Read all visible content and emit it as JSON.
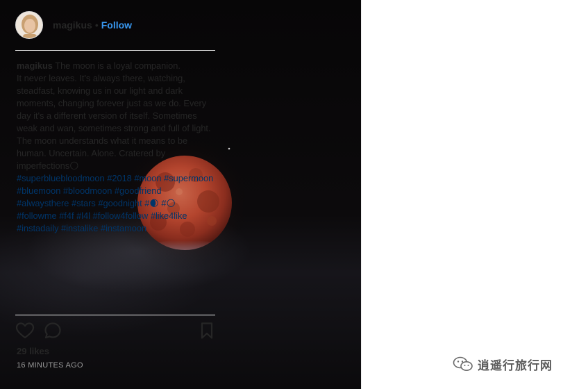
{
  "post": {
    "username": "magikus",
    "separator": "•",
    "follow_label": "Follow",
    "caption_username": "magikus",
    "caption_text": " The moon is a loyal companion.\nIt never leaves. It's always there, watching, steadfast, knowing us in our light and dark moments, changing forever just as we do. Every day it's a different version of itself. Sometimes weak and wan, sometimes strong and full of light. The moon understands what it means to be human. Uncertain. Alone. Cratered by imperfections🌕",
    "hashtags": [
      "#superbluebloodmoon",
      "#2018",
      "#moon",
      "#supermoon",
      "#bluemoon",
      "#bloodmoon",
      "#goodfriend",
      "#alwaysthere",
      "#stars",
      "#goodnight",
      "#🌒",
      "#🌕",
      "#followme",
      "#f4f",
      "#l4l",
      "#follow4follow",
      "#like4like",
      "#instadaily",
      "#instalike",
      "#instamoon"
    ],
    "likes": "29 likes",
    "timestamp": "16 MINUTES AGO"
  },
  "icons": {
    "like": "heart-icon",
    "comment": "comment-icon",
    "save": "bookmark-icon"
  },
  "watermark": {
    "text": "逍遥行旅行网"
  },
  "colors": {
    "link": "#3897f0",
    "hashtag": "#003569",
    "text": "#262626",
    "muted": "#999999",
    "moon": "#b4452e"
  }
}
